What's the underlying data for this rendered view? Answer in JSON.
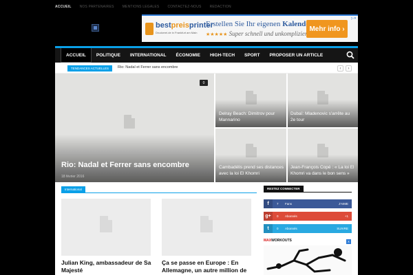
{
  "topnav": [
    "ACCUEIL",
    "NOS PARTENAIRES",
    "MENTIONS LEGALES",
    "CONTACTEZ-NOUS",
    "REDACTION"
  ],
  "ad": {
    "brand_part1": "best",
    "brand_part2": "preis",
    "brand_part3": "printer",
    "brand_tagline": "Druckerei.de in Frankfurt am Main",
    "headline_prefix": "Erstellen Sie Ihr eigenen ",
    "headline_bold": "Kalender",
    "stars": "★★★★★",
    "subline": "Super schnell und unkompliziert!",
    "cta": "Mehr info ›"
  },
  "mainnav": {
    "items": [
      "ACCUEIL",
      "POLITIQUE",
      "INTERNATIONAL",
      "ÉCONOMIE",
      "HIGH-TECH",
      "SPORT",
      "PROPOSER UN ARTICLE"
    ],
    "active": "ACCUEIL"
  },
  "trending": {
    "label": "TENDANCES ACTUELLES",
    "text": "Rio: Nadal et Ferrer sans encombre",
    "prev": "‹",
    "next": "›"
  },
  "featured": {
    "main": {
      "title": "Rio: Nadal et Ferrer sans encombre",
      "date": "18 février 2016",
      "comments": "0"
    },
    "small": [
      {
        "title": "Delray Beach: Dimitrov pour Mannarino"
      },
      {
        "title": "Dubaï: Mladenovic s'arrête au 2e tour"
      },
      {
        "title": "Cambadélis prend ses distances avec la loi El Khomri"
      },
      {
        "title": "Jean-François Copé : « La loi El Khomri va dans le bon sens »"
      }
    ]
  },
  "section": {
    "tag": "International",
    "cards": [
      {
        "title": "Julian King, ambassadeur de Sa Majesté"
      },
      {
        "title": "Ça se passe en Europe : En Allemagne, un autre million de"
      }
    ]
  },
  "sidebar": {
    "heading": "RESTEZ CONNECTER",
    "social": [
      {
        "icon": "f",
        "count": "7",
        "label": "Fans",
        "action": "J'AIME",
        "color": "#3b5998"
      },
      {
        "icon": "g+",
        "count": "0",
        "label": "Abonnés",
        "action": "+1",
        "color": "#dd4b39"
      },
      {
        "icon": "t",
        "count": "0",
        "label": "Abonnés",
        "action": "SUIVRE",
        "color": "#29a9e1"
      }
    ],
    "ad_brand_red": "MAX",
    "ad_brand": "WORKOUTS",
    "ad_close": "x"
  }
}
